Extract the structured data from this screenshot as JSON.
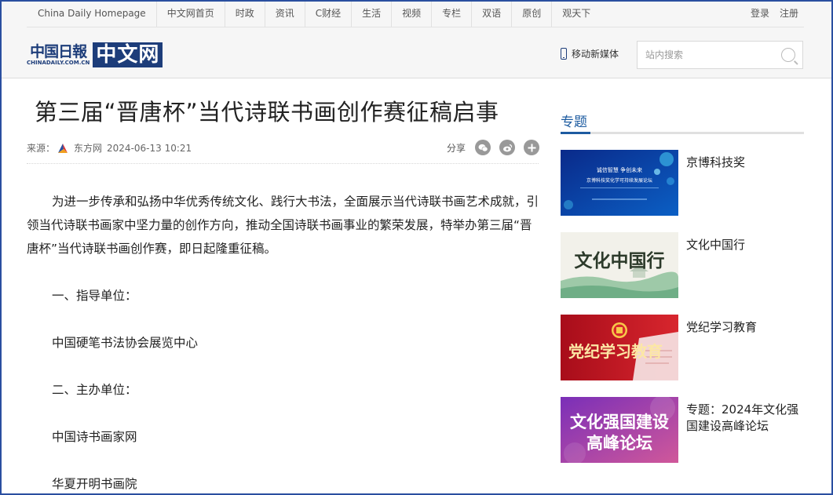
{
  "topnav": [
    "China Daily Homepage",
    "中文网首页",
    "时政",
    "资讯",
    "C财经",
    "生活",
    "视频",
    "专栏",
    "双语",
    "原创",
    "观天下"
  ],
  "auth": {
    "login": "登录",
    "register": "注册"
  },
  "logo": {
    "cd_chinese": "中国日報",
    "cd_english": "CHINADAILY.COM.CN",
    "box_text": "中文网"
  },
  "header": {
    "mobile_label": "移动新媒体",
    "search_placeholder": "站内搜索"
  },
  "article": {
    "title": "第三届“晋唐杯”当代诗联书画创作赛征稿启事",
    "source_label": "来源：",
    "source_name": "东方网",
    "datetime": "2024-06-13 10:21",
    "share_label": "分享",
    "paragraphs": [
      "为进一步传承和弘扬中华优秀传统文化、践行大书法，全面展示当代诗联书画艺术成就，引领当代诗联书画家中坚力量的创作方向，推动全国诗联书画事业的繁荣发展，特举办第三届“晋唐杯”当代诗联书画创作赛，即日起隆重征稿。",
      "一、指导单位：",
      "中国硬笔书法协会展览中心",
      "二、主办单位：",
      "中国诗书画家网",
      "华夏开明书画院"
    ]
  },
  "sidebar": {
    "heading": "专题",
    "items": [
      {
        "label": "京博科技奖",
        "thumb_lines": [
          "诚信智慧 争创未来",
          "京博科技奖化学可持续发展论坛"
        ]
      },
      {
        "label": "文化中国行",
        "thumb_text": "文化中国行"
      },
      {
        "label": "党纪学习教育",
        "thumb_text": "党纪学习教育"
      },
      {
        "label": "专题：2024年文化强国建设高峰论坛",
        "thumb_lines": [
          "文化强国建设",
          "高峰论坛"
        ]
      }
    ]
  },
  "colors": {
    "brand_navy": "#1d3d7a",
    "accent_blue": "#1d5ba0",
    "party_red": "#c8102e"
  }
}
